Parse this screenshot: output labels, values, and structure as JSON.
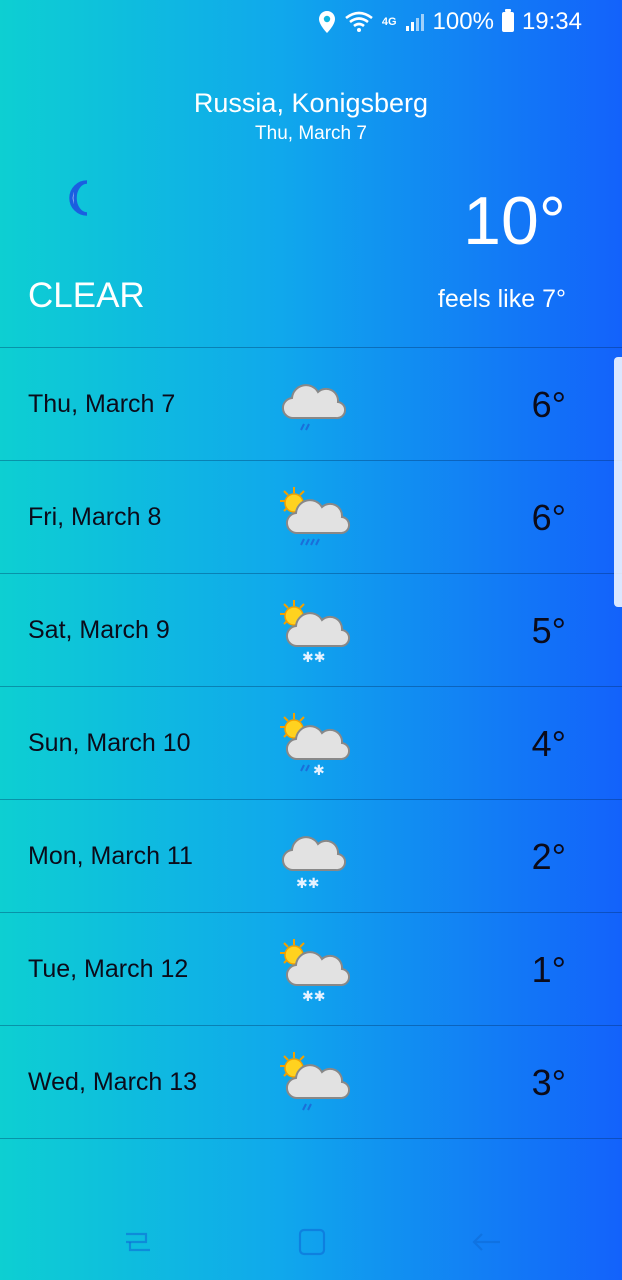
{
  "status_bar": {
    "network_label": "4G",
    "battery_text": "100%",
    "time": "19:34",
    "icons": [
      "location-icon",
      "wifi-icon",
      "signal-icon",
      "battery-icon"
    ]
  },
  "current": {
    "location": "Russia, Konigsberg",
    "date": "Thu, March 7",
    "icon": "moon-icon",
    "temperature": "10°",
    "condition": "CLEAR",
    "feels_like": "feels like 7°"
  },
  "forecast": [
    {
      "date": "Thu, March 7",
      "icon": "cloud-rain-icon",
      "temp": "6°"
    },
    {
      "date": "Fri, March 8",
      "icon": "sun-cloud-rain-icon",
      "temp": "6°"
    },
    {
      "date": "Sat, March 9",
      "icon": "sun-cloud-snow-icon",
      "temp": "5°"
    },
    {
      "date": "Sun, March 10",
      "icon": "sun-cloud-sleet-icon",
      "temp": "4°"
    },
    {
      "date": "Mon, March 11",
      "icon": "cloud-snow-icon",
      "temp": "2°"
    },
    {
      "date": "Tue, March 12",
      "icon": "sun-cloud-snow-icon",
      "temp": "1°"
    },
    {
      "date": "Wed, March 13",
      "icon": "sun-cloud-rain-icon",
      "temp": "3°"
    }
  ],
  "colors": {
    "gradient_left": "#0dcfd2",
    "gradient_right": "#1362fb",
    "row_text": "#0b0b1a"
  },
  "navigation": [
    "recent-apps-icon",
    "home-icon",
    "back-icon"
  ]
}
